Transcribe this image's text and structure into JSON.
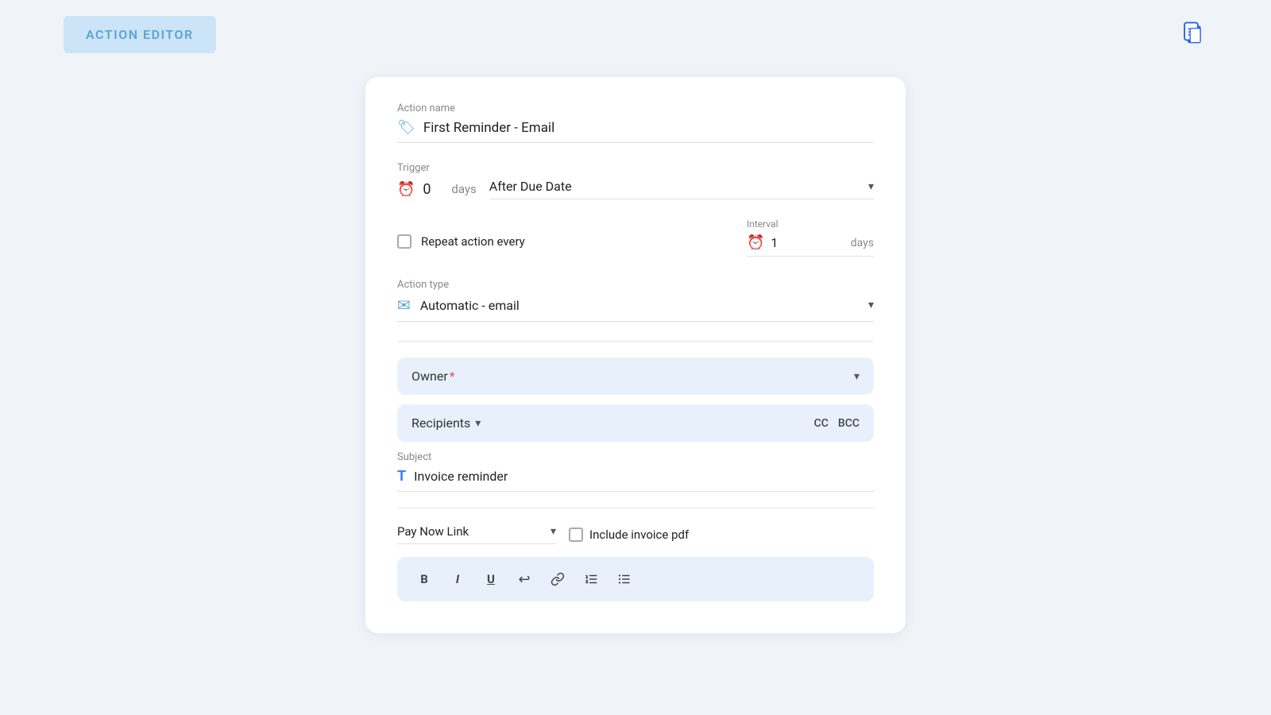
{
  "header": {
    "title": "ACTION EDITOR",
    "copy_icon": "📋"
  },
  "form": {
    "action_name_label": "Action name",
    "action_name_value": "First Reminder - Email",
    "trigger_label": "Trigger",
    "trigger_num": "0",
    "trigger_days": "days",
    "trigger_option": "After Due Date",
    "repeat_label": "Repeat action every",
    "interval_label": "Interval",
    "interval_num": "1",
    "interval_days": "days",
    "action_type_label": "Action type",
    "action_type_value": "Automatic - email",
    "owner_label": "Owner",
    "required_star": "*",
    "recipients_label": "Recipients",
    "cc_label": "CC",
    "bcc_label": "BCC",
    "subject_label": "Subject",
    "subject_value": "Invoice reminder",
    "pay_now_link_label": "Pay Now Link",
    "include_pdf_label": "Include invoice pdf",
    "toolbar": {
      "bold": "B",
      "italic": "I",
      "underline": "U",
      "undo": "↩",
      "link": "🔗",
      "list_ordered": "≡",
      "list_unordered": "≡"
    }
  }
}
